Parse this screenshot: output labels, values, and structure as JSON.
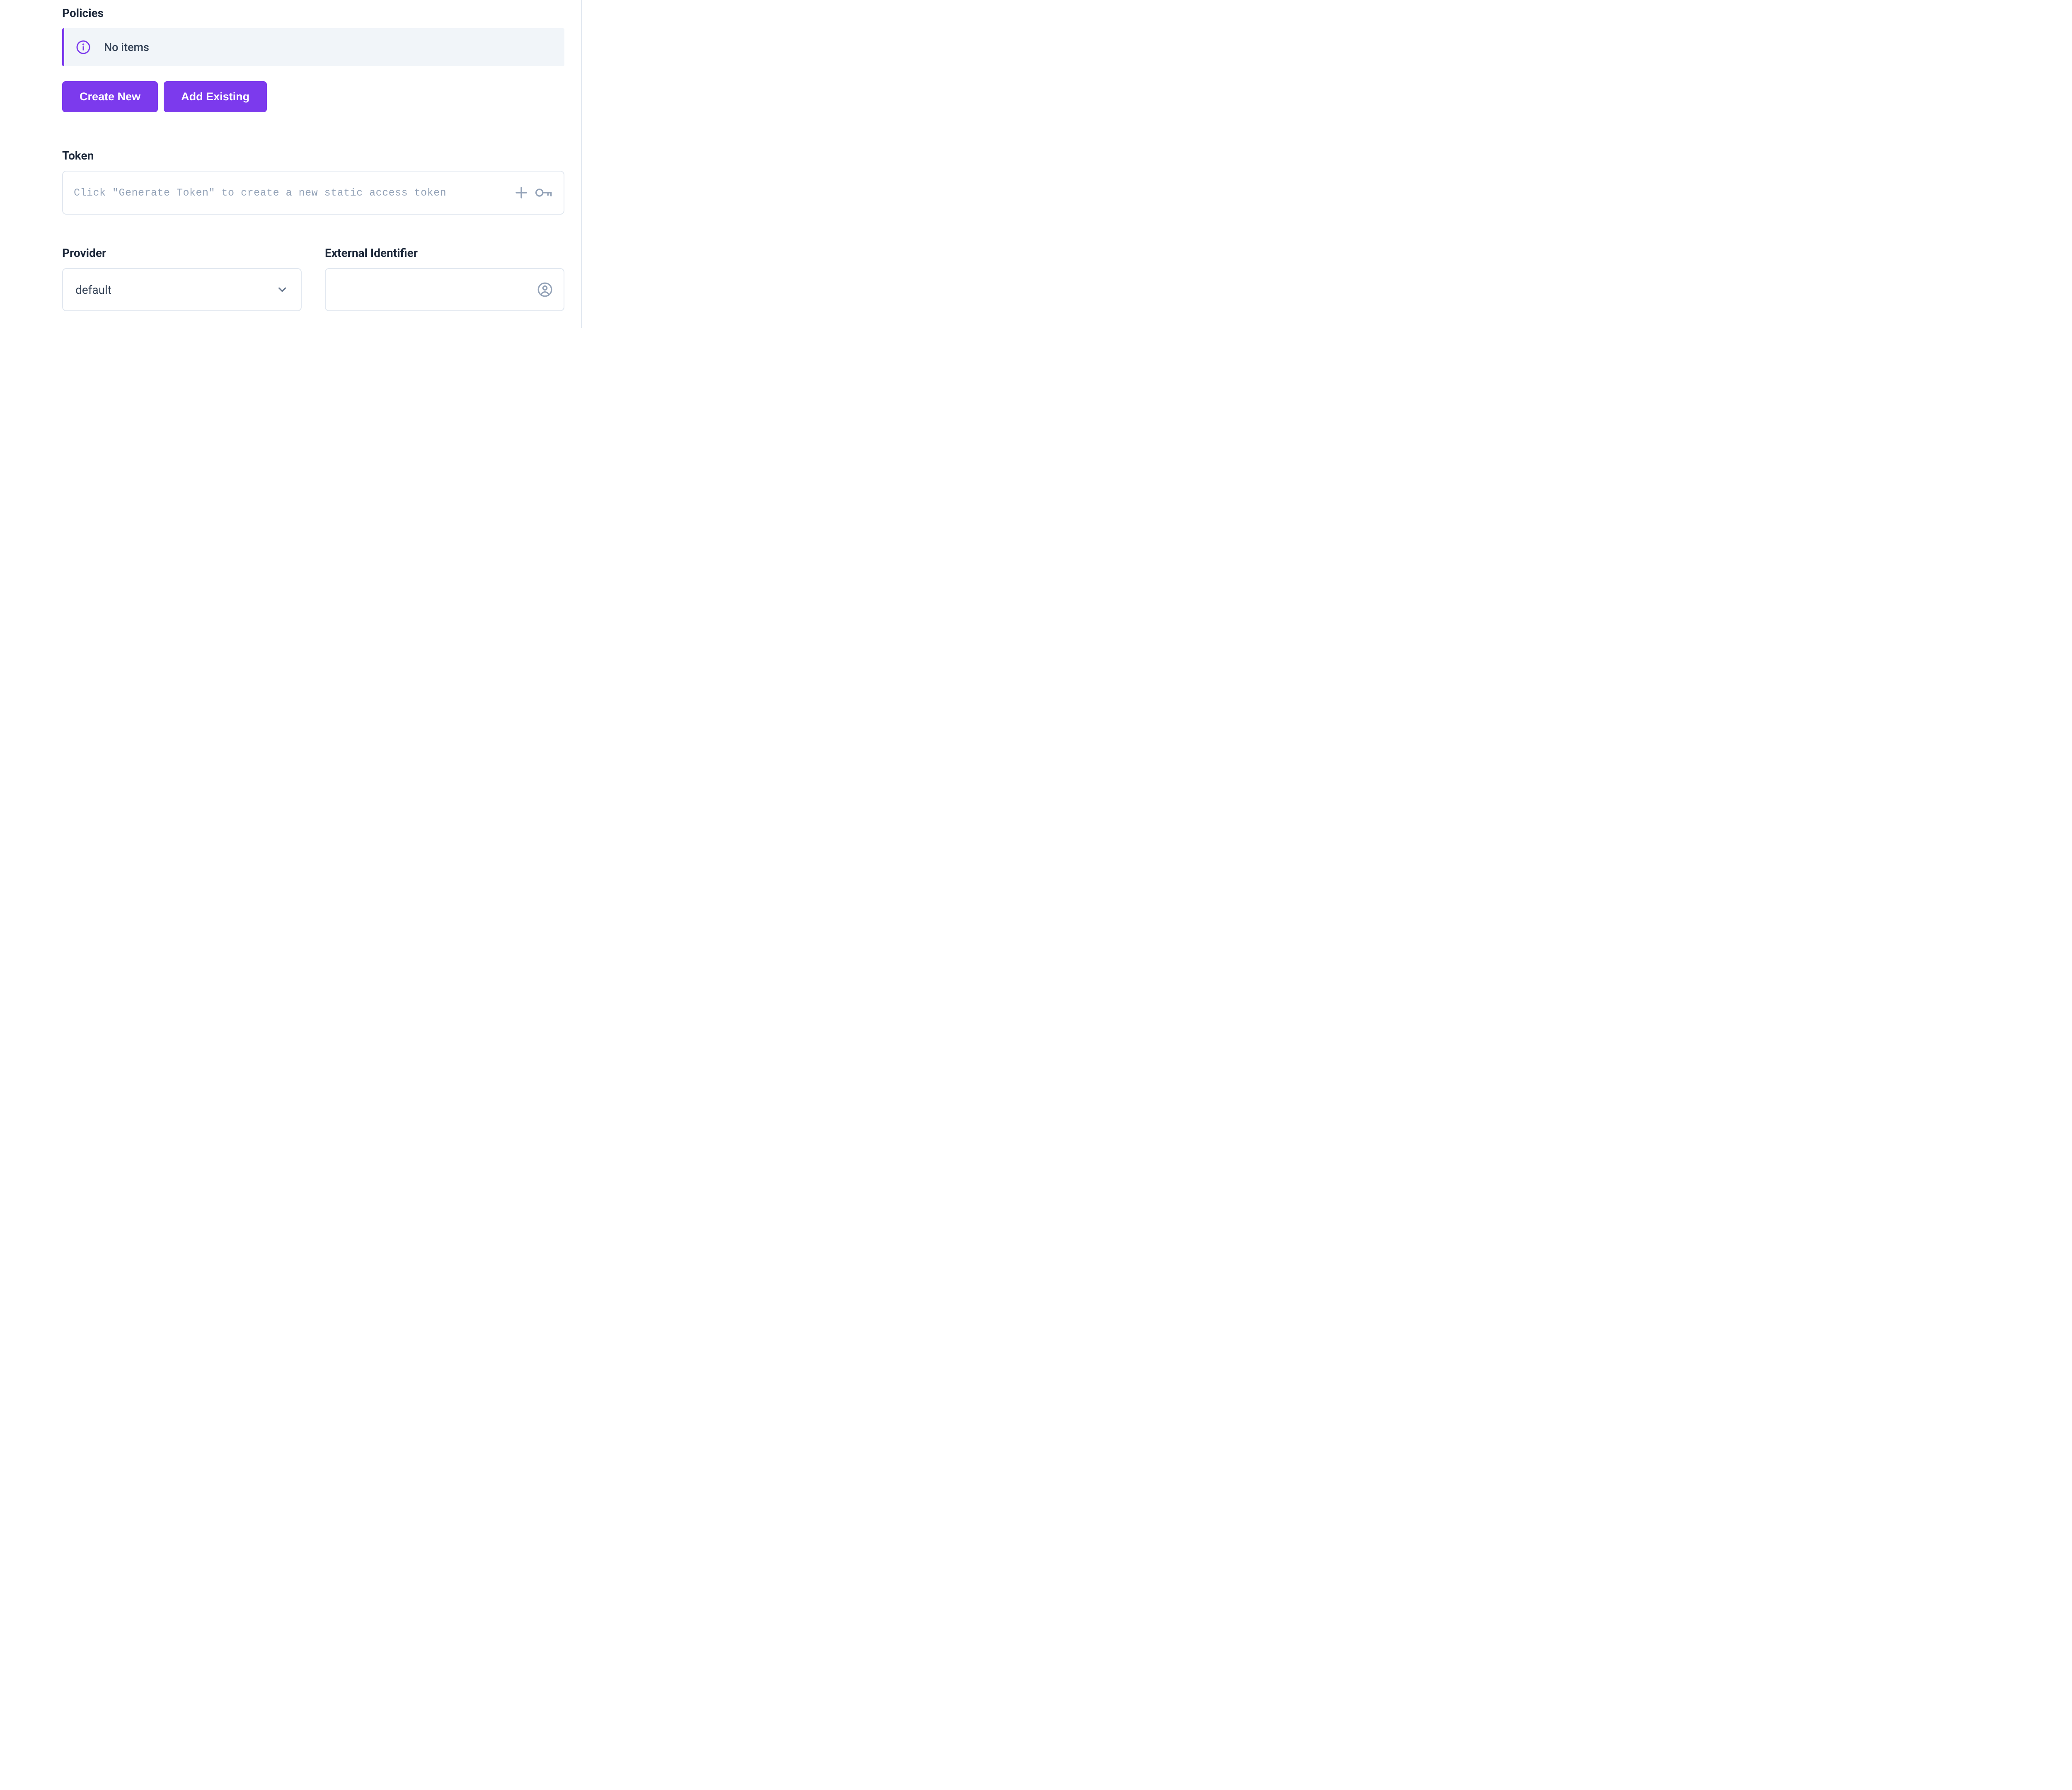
{
  "policies": {
    "heading": "Policies",
    "info_banner": "No items",
    "create_new_label": "Create New",
    "add_existing_label": "Add Existing"
  },
  "token": {
    "heading": "Token",
    "placeholder": "Click \"Generate Token\" to create a new static access token",
    "value": ""
  },
  "provider": {
    "heading": "Provider",
    "selected": "default"
  },
  "external_identifier": {
    "heading": "External Identifier",
    "value": ""
  },
  "colors": {
    "accent": "#7c3aed",
    "text": "#1e293b",
    "border": "#e2e8f0",
    "muted": "#94a3b8",
    "banner_bg": "#f1f5f9"
  }
}
